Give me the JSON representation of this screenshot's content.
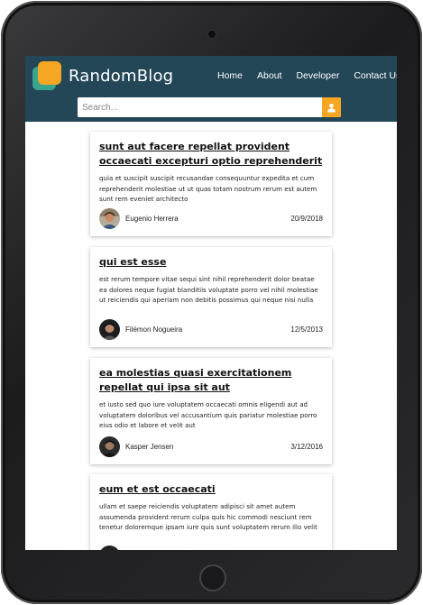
{
  "site": {
    "brand": "RandomBlog",
    "nav": [
      "Home",
      "About",
      "Developer",
      "Contact Us"
    ]
  },
  "search": {
    "placeholder": "Search..."
  },
  "colors": {
    "navbar": "#234757",
    "accent": "#f5a623",
    "logo_secondary": "#3aa58f"
  },
  "posts": [
    {
      "title": "sunt aut facere repellat provident occaecati excepturi optio reprehenderit",
      "body": "quia et suscipit suscipit recusandae consequuntur expedita et cum reprehenderit molestiae ut ut quas totam nostrum rerum est autem sunt rem eveniet architecto",
      "author": "Eugenio Herrera",
      "date": "20/9/2018"
    },
    {
      "title": "qui est esse",
      "body": "est rerum tempore vitae sequi sint nihil reprehenderit dolor beatae ea dolores neque fugiat blanditiis voluptate porro vel nihil molestiae ut reiciendis qui aperiam non debitis possimus qui neque nisi nulla",
      "author": "Filémon Nogueira",
      "date": "12/5/2013"
    },
    {
      "title": "ea molestias quasi exercitationem repellat qui ipsa sit aut",
      "body": "et iusto sed quo iure voluptatem occaecati omnis eligendi aut ad voluptatem doloribus vel accusantium quis pariatur molestiae porro eius odio et labore et velit aut",
      "author": "Kasper Jensen",
      "date": "3/12/2016"
    },
    {
      "title": "eum et est occaecati",
      "body": "ullam et saepe reiciendis voluptatem adipisci sit amet autem assumenda provident rerum culpa quis hic commodi nesciunt rem tenetur doloremque ipsam iure quis sunt voluptatem rerum illo velit"
    }
  ]
}
